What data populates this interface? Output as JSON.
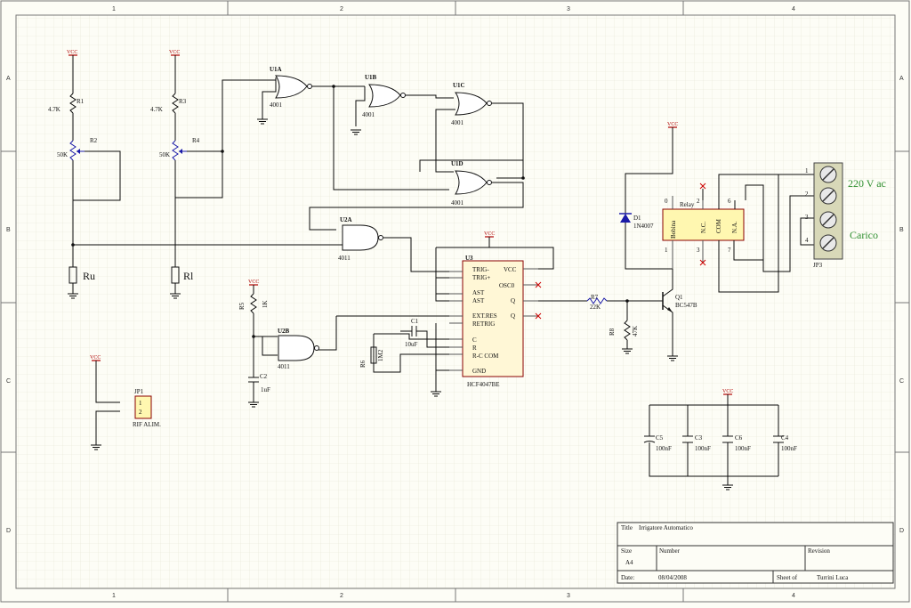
{
  "frame": {
    "cols": [
      "1",
      "2",
      "3",
      "4"
    ],
    "rows": [
      "A",
      "B",
      "C",
      "D"
    ]
  },
  "labels": {
    "vcc": "VCC",
    "ru": "Ru",
    "rl": "Rl",
    "r1": "R1",
    "r1_val": "4.7K",
    "r2": "R2",
    "r2_val": "50K",
    "r3": "R3",
    "r3_val": "4.7K",
    "r4": "R4",
    "r4_val": "50K",
    "u1a": "U1A",
    "u1b": "U1B",
    "u1c": "U1C",
    "u1d": "U1D",
    "u2a": "U2A",
    "u2b": "U2B",
    "u3": "U3",
    "ic4001": "4001",
    "ic4011": "4011",
    "u3_part": "HCF4047BE",
    "u3_pins": [
      "TRIG-",
      "TRIG+",
      "AST",
      "AST",
      "EXT.RES",
      "RETRIG",
      "C",
      "R",
      "R-C COM",
      "GND",
      "VCC",
      "OSC0",
      "Q",
      "Q"
    ],
    "r5": "R5",
    "r5_val": "1K",
    "c2": "C2",
    "c2_val": "1uF",
    "c1": "C1",
    "c1_val": "10uF",
    "r6": "R6",
    "r6_val": "1M2",
    "r7": "R7",
    "r7_val": "22K",
    "r8": "R8",
    "r8_val": "47K",
    "q1": "Q1",
    "q1_part": "BC547B",
    "d1": "D1",
    "d1_part": "1N4007",
    "relay": "Relay",
    "relay_bobina": "Bobina",
    "relay_nc": "N.C.",
    "relay_com": "COM",
    "relay_na": "N.A.",
    "jp1": "JP1",
    "jp1_name": "RIF ALIM.",
    "jp3": "JP3",
    "mains": "220 V ac",
    "load": "Carico",
    "c5": "C5",
    "c3": "C3",
    "c6": "C6",
    "c4": "C4",
    "c100": "100nF"
  },
  "title_block": {
    "title_label": "Title",
    "title": "Irrigatore Automatico",
    "size_label": "Size",
    "size": "A4",
    "number_label": "Number",
    "revision_label": "Revision",
    "date_label": "Date:",
    "date": "08/04/2008",
    "sheet_label": "Sheet of",
    "author": "Turrini Luca"
  },
  "colors": {
    "wire": "#0a0a0a",
    "power": "#b00000",
    "terminal_block": "#2f8f2f",
    "nc_marker": "#cc0000",
    "background": "#fdfdf6"
  }
}
